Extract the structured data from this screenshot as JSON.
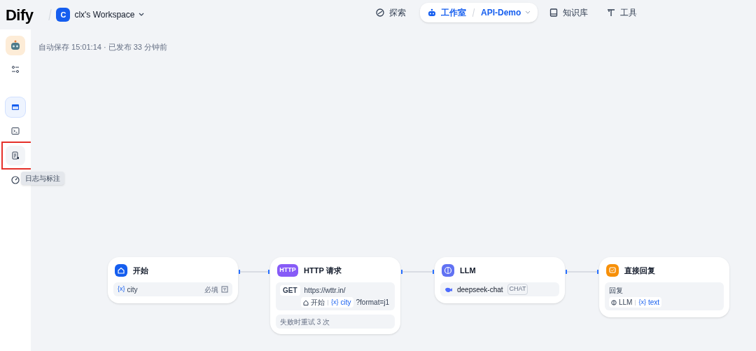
{
  "header": {
    "logo": "Dify",
    "workspace_initial": "C",
    "workspace": "clx's Workspace"
  },
  "nav": [
    {
      "label": "探索",
      "kind": "explore",
      "selected": false
    },
    {
      "label": "工作室",
      "kind": "studio",
      "selected": true,
      "app": "API-Demo"
    },
    {
      "label": "知识库",
      "kind": "knowledge",
      "selected": false
    },
    {
      "label": "工具",
      "kind": "tools",
      "selected": false
    }
  ],
  "sidebar": {
    "items": [
      {
        "kind": "app",
        "selected": false
      },
      {
        "kind": "settings",
        "selected": false
      },
      {
        "kind": "orchestrate",
        "selected": true
      },
      {
        "kind": "api",
        "selected": false
      },
      {
        "kind": "logs",
        "selected": false,
        "highlighted": true,
        "tooltip": "日志与标注"
      },
      {
        "kind": "monitor",
        "selected": false
      }
    ]
  },
  "status": "自动保存 15:01:14 · 已发布 33 分钟前",
  "nodes": [
    {
      "kind": "start",
      "title": "开始",
      "variable": "{x}",
      "name": "city",
      "required": "必填"
    },
    {
      "kind": "http",
      "title": "HTTP 请求",
      "icon_text": "HTTP",
      "method": "GET",
      "url": "https://wttr.in/",
      "ref_node": "开始",
      "ref_var": "{x}",
      "ref_name": "city",
      "suffix": "?format=j1",
      "retry": "失败时重试 3 次"
    },
    {
      "kind": "llm",
      "title": "LLM",
      "model": "deepseek-chat",
      "mode": "CHAT"
    },
    {
      "kind": "answer",
      "title": "直接回复",
      "label": "回复",
      "ref_node": "LLM",
      "ref_var": "{x}",
      "ref_name": "text"
    }
  ]
}
